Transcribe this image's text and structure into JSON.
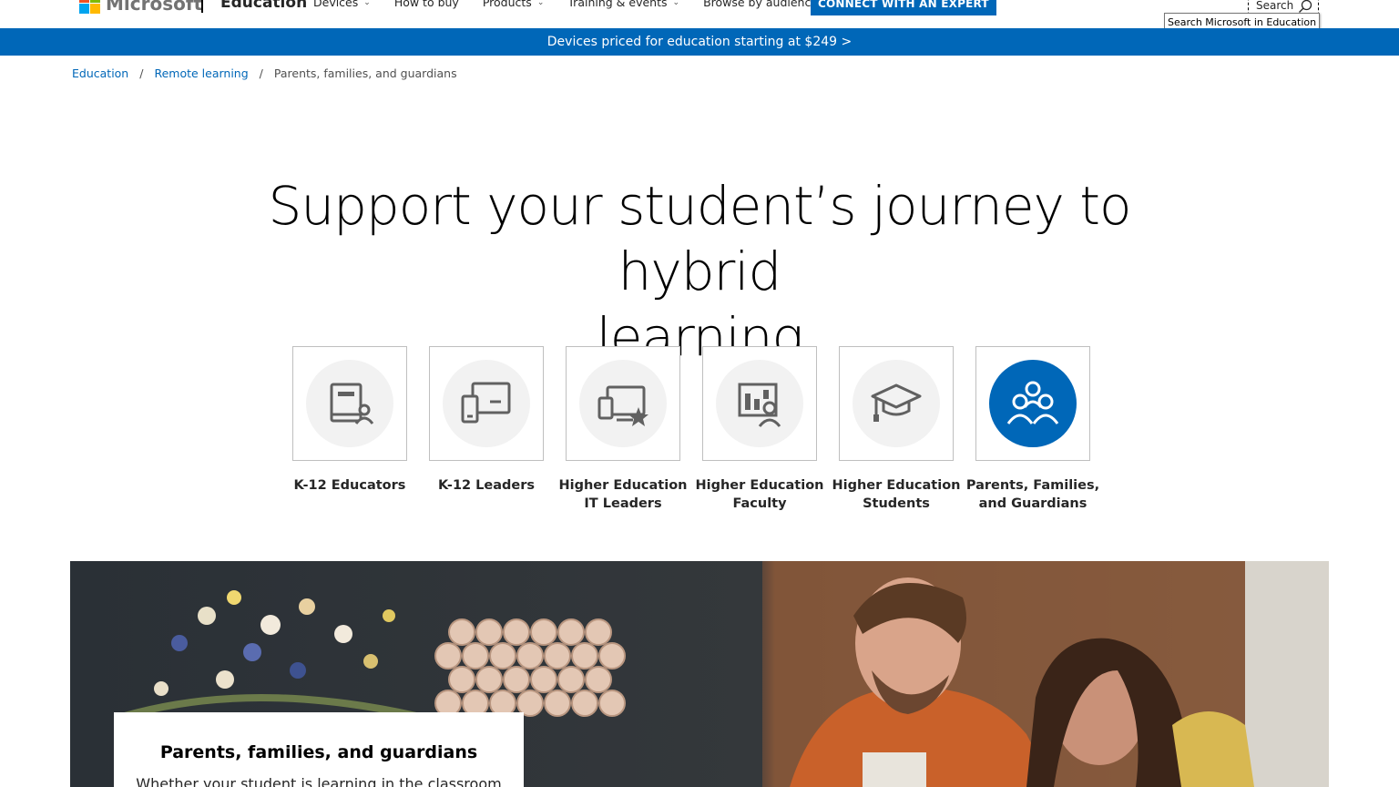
{
  "header": {
    "logo_text": "Microsoft",
    "logo_colors": [
      "#f25022",
      "#7fba00",
      "#00a4ef",
      "#ffb900"
    ],
    "brand": "Education",
    "nav": [
      {
        "label": "Devices",
        "has_dropdown": true
      },
      {
        "label": "How to buy",
        "has_dropdown": false
      },
      {
        "label": "Products",
        "has_dropdown": true
      },
      {
        "label": "Training & events",
        "has_dropdown": true
      },
      {
        "label": "Browse by audience",
        "has_dropdown": true
      }
    ],
    "cta": "CONNECT WITH AN EXPERT",
    "search_label": "Search",
    "search_tooltip": "Search Microsoft in Education",
    "accent": "#0067b8"
  },
  "promo": {
    "text": "Devices priced for education starting at $249 >"
  },
  "breadcrumb": {
    "items": [
      "Education",
      "Remote learning"
    ],
    "separator": "/",
    "current": "Parents, families, and guardians"
  },
  "hero": {
    "title_line1": "Support your student’s journey to hybrid",
    "title_line2": "learning"
  },
  "audiences": [
    {
      "line1": "K-12 Educators",
      "line2": "",
      "icon": "book-person-icon",
      "active": false
    },
    {
      "line1": "K-12 Leaders",
      "line2": "",
      "icon": "devices-icon",
      "active": false
    },
    {
      "line1": "Higher Education",
      "line2": "IT Leaders",
      "icon": "monitor-star-icon",
      "active": false
    },
    {
      "line1": "Higher Education",
      "line2": "Faculty",
      "icon": "chart-person-icon",
      "active": false
    },
    {
      "line1": "Higher Education",
      "line2": "Students",
      "icon": "graduation-cap-icon",
      "active": false
    },
    {
      "line1": "Parents, Families,",
      "line2": "and Guardians",
      "icon": "family-icon",
      "active": true
    }
  ],
  "feature": {
    "card_title": "Parents, families, and guardians",
    "card_text": "Whether your student is learning in the classroom"
  }
}
